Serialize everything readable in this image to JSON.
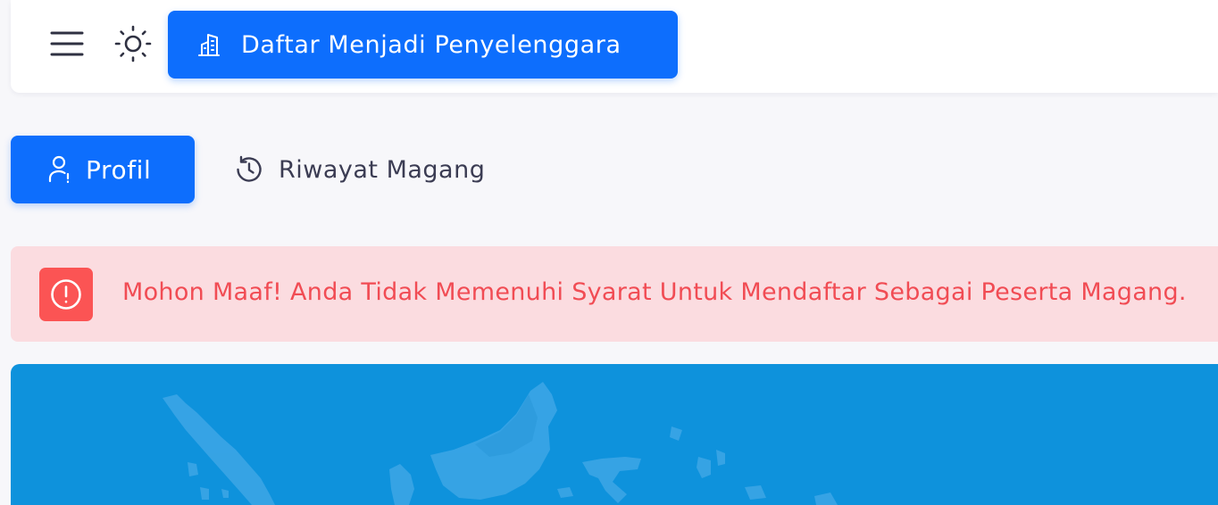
{
  "header": {
    "menu_icon": "hamburger-menu-icon",
    "theme_icon": "sun-icon",
    "register_button": {
      "label": "Daftar Menjadi Penyelenggara",
      "icon": "building-icon"
    }
  },
  "tabs": [
    {
      "label": "Profil",
      "icon": "user-icon",
      "active": true
    },
    {
      "label": "Riwayat Magang",
      "icon": "history-icon",
      "active": false
    }
  ],
  "alert": {
    "icon": "exclamation-circle-icon",
    "message": "Mohon Maaf! Anda Tidak Memenuhi Syarat Untuk Mendaftar Sebagai Peserta Magang."
  },
  "banner": {
    "image": "indonesia-map-illustration"
  },
  "colors": {
    "primary": "#0d6efd",
    "alert_bg": "#fbdce0",
    "alert_text": "#f14c54",
    "alert_icon_bg": "#fb5454",
    "banner_bg": "#0e92dc",
    "page_bg": "#f7f7fa"
  }
}
